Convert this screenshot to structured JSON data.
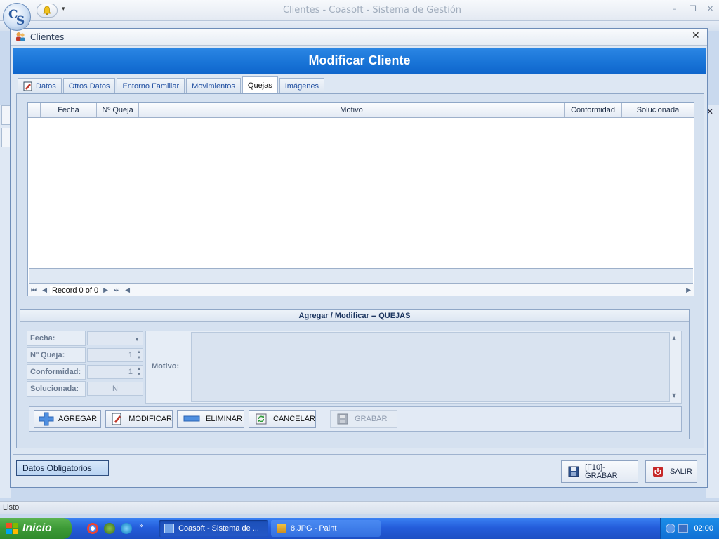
{
  "app": {
    "title": "Clientes - Coasoft - Sistema de Gestión",
    "logo_text_c": "C",
    "logo_text_s": "S",
    "qat_dropdown": "▾",
    "min": "–",
    "max": "❐",
    "close": "✕"
  },
  "dialog": {
    "title": "Clientes",
    "close": "✕",
    "header": "Modificar Cliente"
  },
  "tabs": [
    {
      "label": "Datos",
      "active": false
    },
    {
      "label": "Otros Datos",
      "active": false
    },
    {
      "label": "Entorno Familiar",
      "active": false
    },
    {
      "label": "Movimientos",
      "active": false
    },
    {
      "label": "Quejas",
      "active": true
    },
    {
      "label": "Imágenes",
      "active": false
    }
  ],
  "grid": {
    "columns": [
      "Fecha",
      "Nº Queja",
      "Motivo",
      "Conformidad",
      "Solucionada"
    ],
    "rows": [],
    "nav": {
      "first": "⏮",
      "prev": "◀",
      "record": "Record 0 of 0",
      "next": "▶",
      "last": "⏭",
      "scroll_left": "◀",
      "scroll_right": "▶"
    }
  },
  "edit": {
    "title": "Agregar / Modificar -- QUEJAS",
    "fields": {
      "fecha_label": "Fecha:",
      "fecha_value": "",
      "numero_label": "Nº Queja:",
      "numero_value": "1",
      "conformidad_label": "Conformidad:",
      "conformidad_value": "1",
      "solucionada_label": "Solucionada:",
      "solucionada_value": "N"
    },
    "motivo_label": "Motivo:",
    "motivo_value": "",
    "buttons": {
      "agregar": "AGREGAR",
      "modificar": "MODIFICAR",
      "eliminar": "ELIMINAR",
      "cancelar": "CANCELAR",
      "grabar": "GRABAR"
    }
  },
  "bottom": {
    "datos_obligatorios": "Datos Obligatorios",
    "grabar_f10": "[F10]- GRABAR",
    "salir": "SALIR"
  },
  "status": {
    "text": "Listo"
  },
  "taskbar": {
    "start": "Inicio",
    "tasks": [
      {
        "label": "Coasoft - Sistema de ..."
      },
      {
        "label": "8.JPG - Paint"
      }
    ],
    "clock": "02:00"
  },
  "colors": {
    "header_blue": "#1873d6",
    "taskbar_blue": "#245ddb",
    "start_green": "#3c9a36"
  }
}
